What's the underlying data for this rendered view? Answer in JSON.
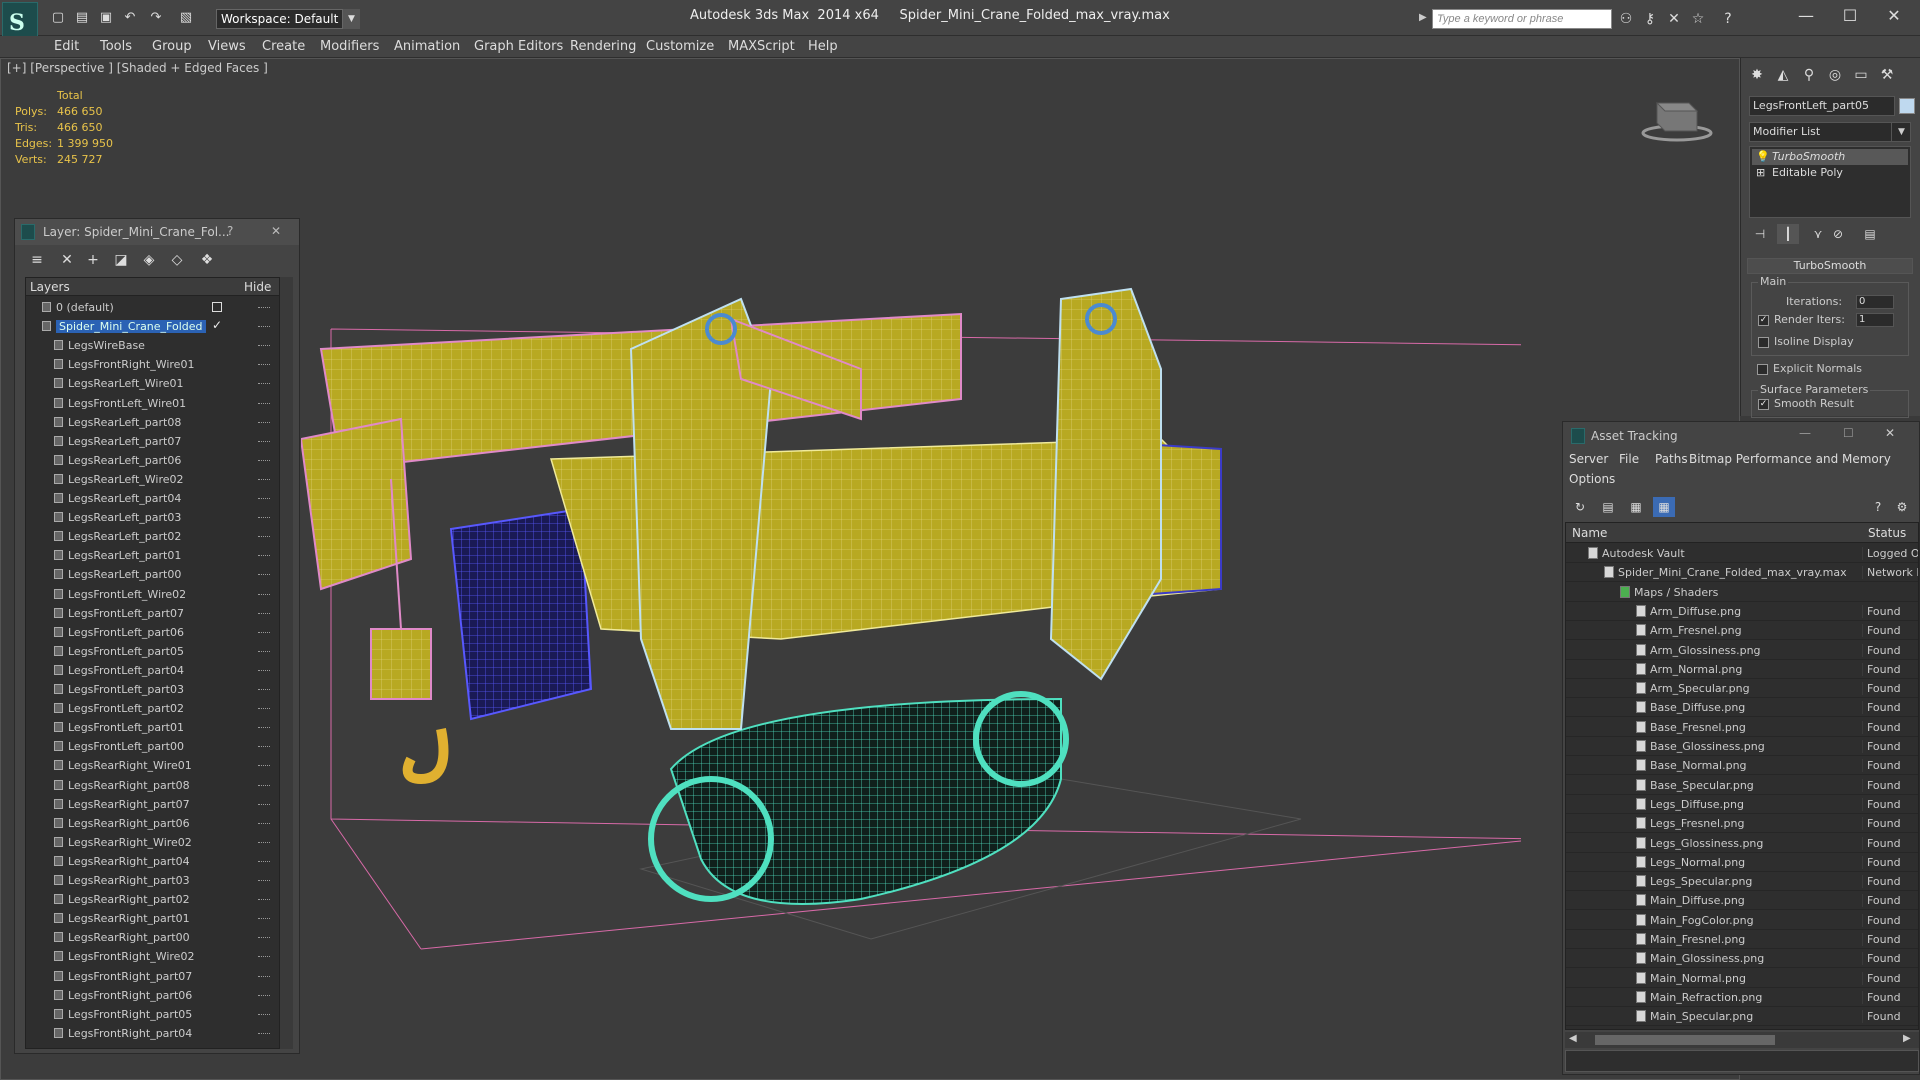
{
  "titlebar": {
    "workspace": "Workspace: Default",
    "title": "Autodesk 3ds Max  2014 x64     Spider_Mini_Crane_Folded_max_vray.max",
    "search_placeholder": "Type a keyword or phrase",
    "icons": [
      "new-file-icon",
      "open-folder-icon",
      "save-icon",
      "undo-icon",
      "redo-icon",
      "project-icon"
    ]
  },
  "menu": [
    "Edit",
    "Tools",
    "Group",
    "Views",
    "Create",
    "Modifiers",
    "Animation",
    "Graph Editors",
    "Rendering",
    "Customize",
    "MAXScript",
    "Help"
  ],
  "viewport": {
    "label": "[+] [Perspective ] [Shaded + Edged Faces ]",
    "stats": {
      "header": "Total",
      "rows": [
        {
          "label": "Polys:",
          "value": "466 650"
        },
        {
          "label": "Tris:",
          "value": "466 650"
        },
        {
          "label": "Edges:",
          "value": "1 399 950"
        },
        {
          "label": "Verts:",
          "value": "245 727"
        }
      ]
    }
  },
  "layer_panel": {
    "title": "Layer: Spider_Mini_Crane_Fol...",
    "help": "?",
    "close": "✕",
    "col_layers": "Layers",
    "col_hide": "Hide",
    "rows": [
      {
        "name": "0 (default)",
        "level": 1
      },
      {
        "name": "Spider_Mini_Crane_Folded",
        "level": 1,
        "selected": true
      },
      {
        "name": "LegsWireBase",
        "level": 2
      },
      {
        "name": "LegsFrontRight_Wire01",
        "level": 2
      },
      {
        "name": "LegsRearLeft_Wire01",
        "level": 2
      },
      {
        "name": "LegsFrontLeft_Wire01",
        "level": 2
      },
      {
        "name": "LegsRearLeft_part08",
        "level": 2
      },
      {
        "name": "LegsRearLeft_part07",
        "level": 2
      },
      {
        "name": "LegsRearLeft_part06",
        "level": 2
      },
      {
        "name": "LegsRearLeft_Wire02",
        "level": 2
      },
      {
        "name": "LegsRearLeft_part04",
        "level": 2
      },
      {
        "name": "LegsRearLeft_part03",
        "level": 2
      },
      {
        "name": "LegsRearLeft_part02",
        "level": 2
      },
      {
        "name": "LegsRearLeft_part01",
        "level": 2
      },
      {
        "name": "LegsRearLeft_part00",
        "level": 2
      },
      {
        "name": "LegsFrontLeft_Wire02",
        "level": 2
      },
      {
        "name": "LegsFrontLeft_part07",
        "level": 2
      },
      {
        "name": "LegsFrontLeft_part06",
        "level": 2
      },
      {
        "name": "LegsFrontLeft_part05",
        "level": 2
      },
      {
        "name": "LegsFrontLeft_part04",
        "level": 2
      },
      {
        "name": "LegsFrontLeft_part03",
        "level": 2
      },
      {
        "name": "LegsFrontLeft_part02",
        "level": 2
      },
      {
        "name": "LegsFrontLeft_part01",
        "level": 2
      },
      {
        "name": "LegsFrontLeft_part00",
        "level": 2
      },
      {
        "name": "LegsRearRight_Wire01",
        "level": 2
      },
      {
        "name": "LegsRearRight_part08",
        "level": 2
      },
      {
        "name": "LegsRearRight_part07",
        "level": 2
      },
      {
        "name": "LegsRearRight_part06",
        "level": 2
      },
      {
        "name": "LegsRearRight_Wire02",
        "level": 2
      },
      {
        "name": "LegsRearRight_part04",
        "level": 2
      },
      {
        "name": "LegsRearRight_part03",
        "level": 2
      },
      {
        "name": "LegsRearRight_part02",
        "level": 2
      },
      {
        "name": "LegsRearRight_part01",
        "level": 2
      },
      {
        "name": "LegsRearRight_part00",
        "level": 2
      },
      {
        "name": "LegsFrontRight_Wire02",
        "level": 2
      },
      {
        "name": "LegsFrontRight_part07",
        "level": 2
      },
      {
        "name": "LegsFrontRight_part06",
        "level": 2
      },
      {
        "name": "LegsFrontRight_part05",
        "level": 2
      },
      {
        "name": "LegsFrontRight_part04",
        "level": 2
      }
    ]
  },
  "command_panel": {
    "object_name": "LegsFrontLeft_part05",
    "modifier_list": "Modifier List",
    "stack": [
      "TurboSmooth",
      "Editable Poly"
    ],
    "rollout_title": "TurboSmooth",
    "main_group": "Main",
    "iterations_label": "Iterations:",
    "iterations_value": "0",
    "render_iters_label": "Render Iters:",
    "render_iters_value": "1",
    "isoline_label": "Isoline Display",
    "explicit_label": "Explicit Normals",
    "surface_group": "Surface Parameters",
    "smooth_result_label": "Smooth Result"
  },
  "asset_panel": {
    "title": "Asset Tracking",
    "menu": [
      "Server",
      "File",
      "Paths",
      "Bitmap Performance and Memory",
      "Options"
    ],
    "col_name": "Name",
    "col_status": "Status",
    "rows": [
      {
        "name": "Autodesk Vault",
        "status": "Logged O",
        "level": 0
      },
      {
        "name": "Spider_Mini_Crane_Folded_max_vray.max",
        "status": "Network P",
        "level": 1
      },
      {
        "name": "Maps / Shaders",
        "status": "",
        "level": 2
      },
      {
        "name": "Arm_Diffuse.png",
        "status": "Found",
        "level": 3
      },
      {
        "name": "Arm_Fresnel.png",
        "status": "Found",
        "level": 3
      },
      {
        "name": "Arm_Glossiness.png",
        "status": "Found",
        "level": 3
      },
      {
        "name": "Arm_Normal.png",
        "status": "Found",
        "level": 3
      },
      {
        "name": "Arm_Specular.png",
        "status": "Found",
        "level": 3
      },
      {
        "name": "Base_Diffuse.png",
        "status": "Found",
        "level": 3
      },
      {
        "name": "Base_Fresnel.png",
        "status": "Found",
        "level": 3
      },
      {
        "name": "Base_Glossiness.png",
        "status": "Found",
        "level": 3
      },
      {
        "name": "Base_Normal.png",
        "status": "Found",
        "level": 3
      },
      {
        "name": "Base_Specular.png",
        "status": "Found",
        "level": 3
      },
      {
        "name": "Legs_Diffuse.png",
        "status": "Found",
        "level": 3
      },
      {
        "name": "Legs_Fresnel.png",
        "status": "Found",
        "level": 3
      },
      {
        "name": "Legs_Glossiness.png",
        "status": "Found",
        "level": 3
      },
      {
        "name": "Legs_Normal.png",
        "status": "Found",
        "level": 3
      },
      {
        "name": "Legs_Specular.png",
        "status": "Found",
        "level": 3
      },
      {
        "name": "Main_Diffuse.png",
        "status": "Found",
        "level": 3
      },
      {
        "name": "Main_FogColor.png",
        "status": "Found",
        "level": 3
      },
      {
        "name": "Main_Fresnel.png",
        "status": "Found",
        "level": 3
      },
      {
        "name": "Main_Glossiness.png",
        "status": "Found",
        "level": 3
      },
      {
        "name": "Main_Normal.png",
        "status": "Found",
        "level": 3
      },
      {
        "name": "Main_Refraction.png",
        "status": "Found",
        "level": 3
      },
      {
        "name": "Main_Specular.png",
        "status": "Found",
        "level": 3
      }
    ]
  },
  "colors": {
    "selection": "#2b62b4",
    "stats": "#e8c34a",
    "wire_yellow": "#c9b820",
    "wire_pink": "#e08ac8",
    "wire_teal": "#4fe0c0",
    "wire_blue": "#3a3ad0"
  }
}
